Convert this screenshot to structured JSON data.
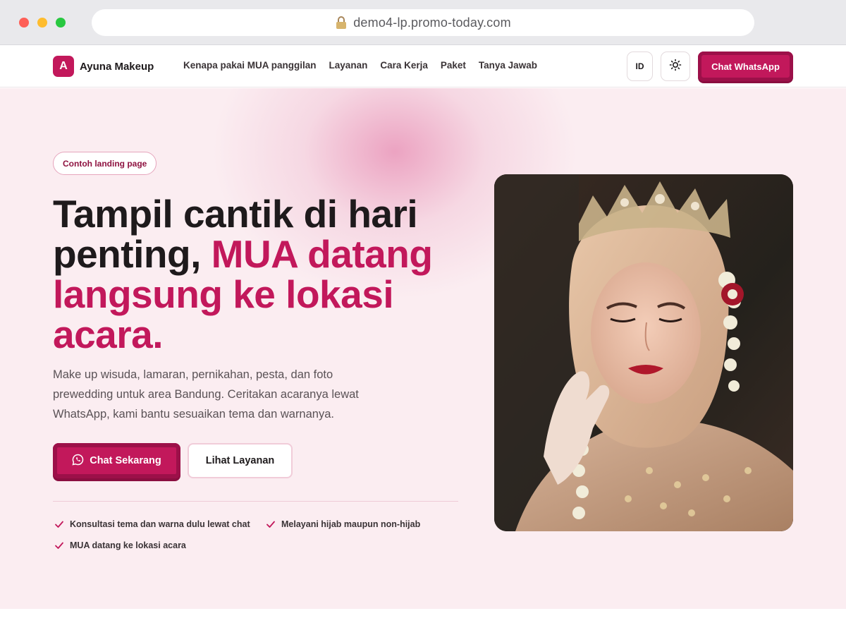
{
  "browser": {
    "url": "demo4-lp.promo-today.com"
  },
  "nav": {
    "logo_letter": "A",
    "brand": "Ayuna Makeup",
    "links": [
      "Kenapa pakai MUA panggilan",
      "Layanan",
      "Cara Kerja",
      "Paket",
      "Tanya Jawab"
    ],
    "lang_label": "ID",
    "cta_label": "Chat WhatsApp"
  },
  "hero": {
    "badge": "Contoh landing page",
    "headline_part1": "Tampil cantik di hari penting, ",
    "headline_accent": "MUA datang langsung ke lokasi acara.",
    "description": "Make up wisuda, lamaran, pernikahan, pesta, dan foto prewedding untuk area Bandung. Ceritakan acaranya lewat WhatsApp, kami bantu sesuaikan tema dan warnanya.",
    "primary_button": "Chat Sekarang",
    "secondary_button": "Lihat Layanan",
    "features": [
      "Konsultasi tema dan warna dulu lewat chat",
      "Melayani hijab maupun non-hijab",
      "MUA datang ke lokasi acara"
    ]
  },
  "colors": {
    "accent": "#c2185b",
    "accent_dark": "#9c1049",
    "hero_bg": "#fbedf1"
  },
  "icons": {
    "lock": "lock-icon",
    "theme": "sun-icon",
    "whatsapp": "whatsapp-icon",
    "check": "check-icon"
  }
}
